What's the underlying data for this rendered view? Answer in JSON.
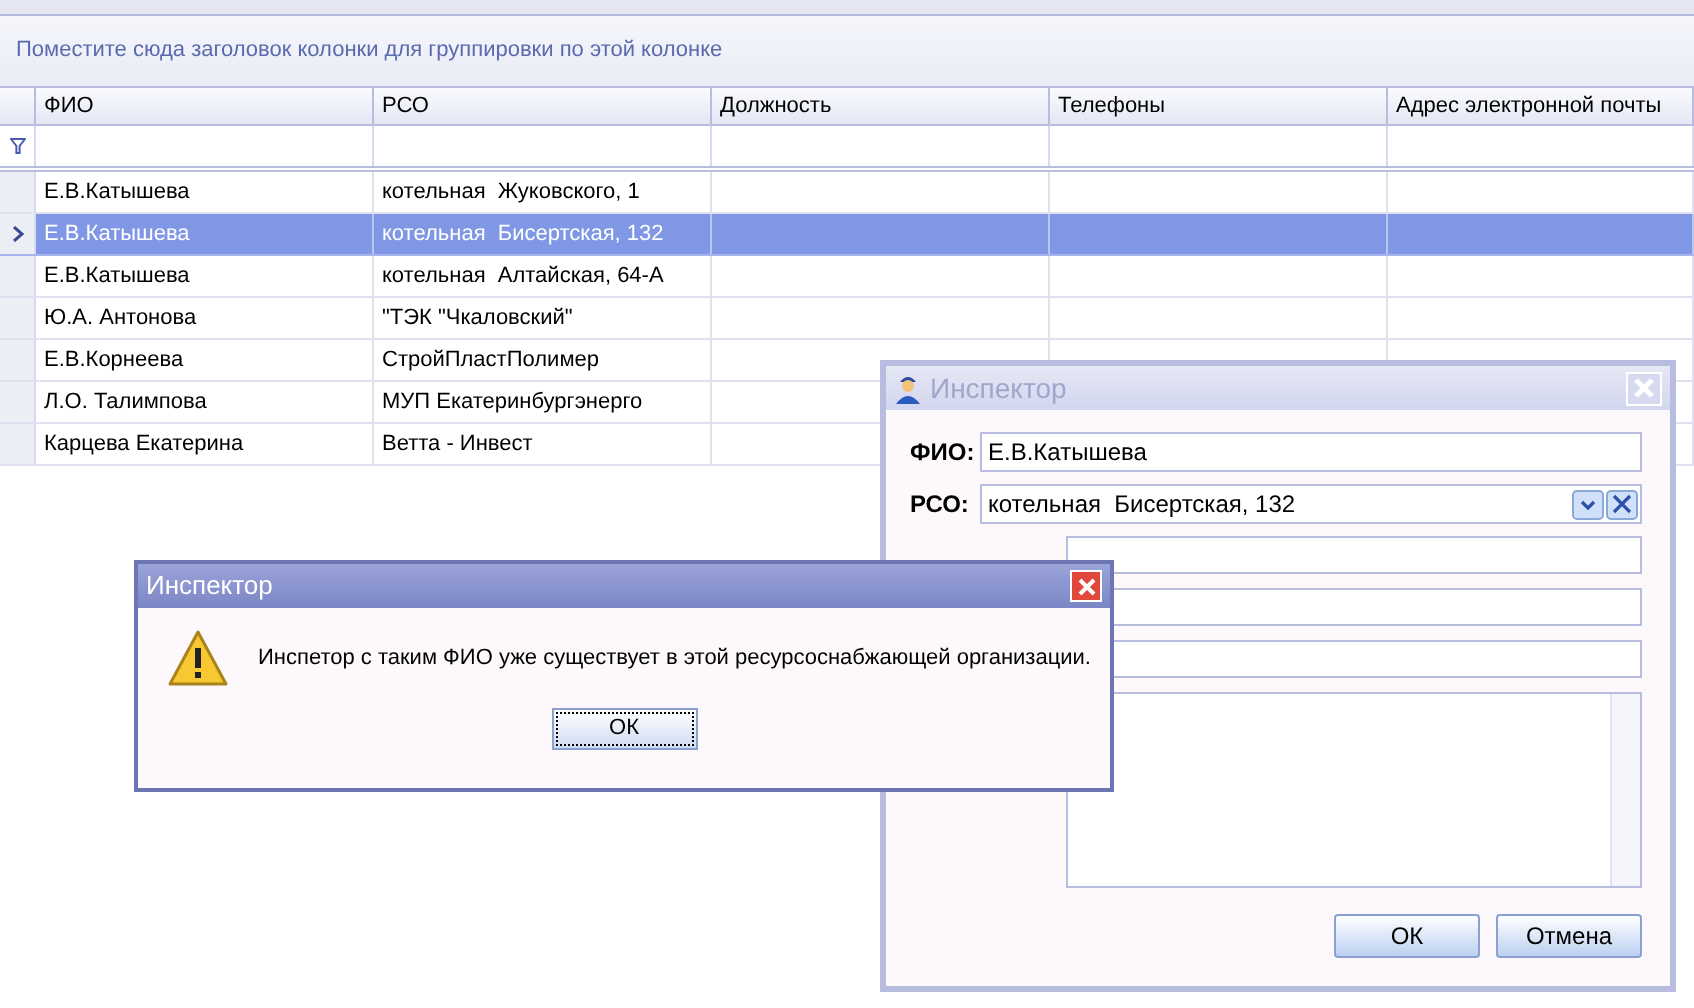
{
  "group_panel": {
    "hint": "Поместите сюда заголовок колонки для группировки по этой колонке"
  },
  "table": {
    "columns": [
      "ФИО",
      "РСО",
      "Должность",
      "Телефоны",
      "Адрес электронной почты"
    ],
    "rows": [
      {
        "selected": false,
        "cells": [
          "Е.В.Катышева",
          "котельная  Жуковского, 1",
          "",
          "",
          ""
        ]
      },
      {
        "selected": true,
        "cells": [
          "Е.В.Катышева",
          "котельная  Бисертская, 132",
          "",
          "",
          ""
        ]
      },
      {
        "selected": false,
        "cells": [
          "Е.В.Катышева",
          "котельная  Алтайская, 64-А",
          "",
          "",
          ""
        ]
      },
      {
        "selected": false,
        "cells": [
          "Ю.А. Антонова",
          "\"ТЭК \"Чкаловский\"",
          "",
          "",
          ""
        ]
      },
      {
        "selected": false,
        "cells": [
          "Е.В.Корнеева",
          "СтройПластПолимер",
          "",
          "",
          ""
        ]
      },
      {
        "selected": false,
        "cells": [
          "Л.О. Талимпова",
          "МУП Екатеринбургэнерго",
          "",
          "",
          ""
        ]
      },
      {
        "selected": false,
        "cells": [
          "Карцева Екатерина",
          "Ветта - Инвест",
          "",
          "",
          ""
        ]
      }
    ]
  },
  "inspector_window": {
    "title": "Инспектор",
    "fio_label": "ФИО:",
    "fio_value": "Е.В.Катышева",
    "rso_label": "РСО:",
    "rso_value": "котельная  Бисертская, 132",
    "buttons": [
      "ОК",
      "Отмена"
    ]
  },
  "message_box": {
    "title": "Инспектор",
    "message": "Инспетор с таким ФИО уже существует в этой ресурсоснабжающей организации.",
    "button": "ОК"
  }
}
